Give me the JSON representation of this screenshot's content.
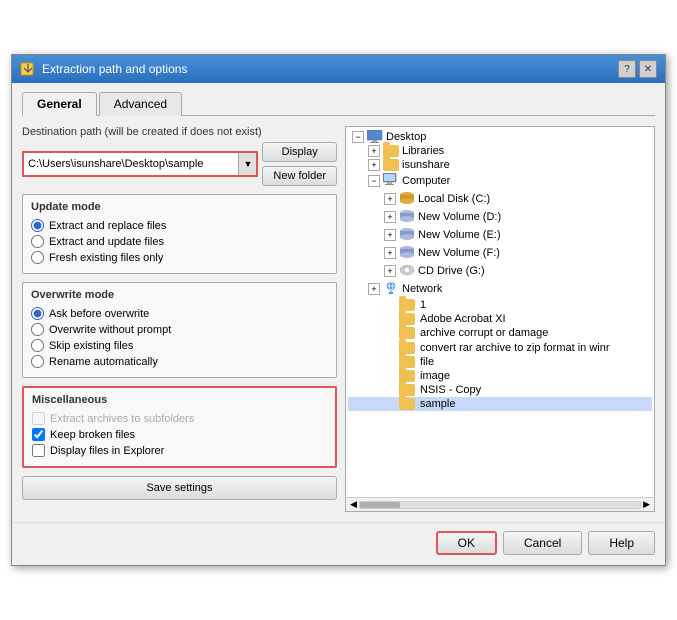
{
  "dialog": {
    "title": "Extraction path and options",
    "icon": "extract-icon"
  },
  "tabs": {
    "general": "General",
    "advanced": "Advanced"
  },
  "dest_path": {
    "label": "Destination path (will be created if does not exist)",
    "value": "C:\\Users\\isunshare\\Desktop\\sample",
    "display_btn": "Display",
    "new_folder_btn": "New folder"
  },
  "update_mode": {
    "label": "Update mode",
    "options": [
      {
        "id": "extract_replace",
        "label": "Extract and replace files",
        "checked": true
      },
      {
        "id": "extract_update",
        "label": "Extract and update files",
        "checked": false
      },
      {
        "id": "fresh_existing",
        "label": "Fresh existing files only",
        "checked": false
      }
    ]
  },
  "overwrite_mode": {
    "label": "Overwrite mode",
    "options": [
      {
        "id": "ask_before",
        "label": "Ask before overwrite",
        "checked": true
      },
      {
        "id": "overwrite_no_prompt",
        "label": "Overwrite without prompt",
        "checked": false
      },
      {
        "id": "skip_existing",
        "label": "Skip existing files",
        "checked": false
      },
      {
        "id": "rename_auto",
        "label": "Rename automatically",
        "checked": false
      }
    ]
  },
  "misc": {
    "label": "Miscellaneous",
    "options": [
      {
        "id": "extract_subfolders",
        "label": "Extract archives to subfolders",
        "checked": false,
        "enabled": false
      },
      {
        "id": "keep_broken",
        "label": "Keep broken files",
        "checked": true,
        "enabled": true
      },
      {
        "id": "display_explorer",
        "label": "Display files in Explorer",
        "checked": false,
        "enabled": true
      }
    ]
  },
  "save_settings": "Save settings",
  "tree": {
    "items": [
      {
        "level": 1,
        "expand": true,
        "label": "Desktop",
        "type": "desktop",
        "indent": 0
      },
      {
        "level": 2,
        "expand": true,
        "label": "Libraries",
        "type": "folder",
        "indent": 1
      },
      {
        "level": 2,
        "expand": true,
        "label": "isunshare",
        "type": "folder",
        "indent": 1
      },
      {
        "level": 2,
        "expand": false,
        "label": "Computer",
        "type": "computer",
        "indent": 1
      },
      {
        "level": 3,
        "expand": false,
        "label": "Local Disk (C:)",
        "type": "disk",
        "indent": 2
      },
      {
        "level": 3,
        "expand": false,
        "label": "New Volume (D:)",
        "type": "disk",
        "indent": 2
      },
      {
        "level": 3,
        "expand": false,
        "label": "New Volume (E:)",
        "type": "disk",
        "indent": 2
      },
      {
        "level": 3,
        "expand": false,
        "label": "New Volume (F:)",
        "type": "disk",
        "indent": 2
      },
      {
        "level": 3,
        "expand": false,
        "label": "CD Drive (G:)",
        "type": "disk",
        "indent": 2
      },
      {
        "level": 2,
        "expand": true,
        "label": "Network",
        "type": "network",
        "indent": 1
      },
      {
        "level": 3,
        "expand": false,
        "label": "1",
        "type": "folder",
        "indent": 2
      },
      {
        "level": 3,
        "expand": false,
        "label": "Adobe Acrobat XI",
        "type": "folder",
        "indent": 2
      },
      {
        "level": 3,
        "expand": false,
        "label": "archive corrupt or damage",
        "type": "folder",
        "indent": 2
      },
      {
        "level": 3,
        "expand": false,
        "label": "convert rar archive to zip format in winr",
        "type": "folder",
        "indent": 2
      },
      {
        "level": 3,
        "expand": false,
        "label": "file",
        "type": "folder",
        "indent": 2
      },
      {
        "level": 3,
        "expand": false,
        "label": "image",
        "type": "folder",
        "indent": 2
      },
      {
        "level": 3,
        "expand": false,
        "label": "NSIS - Copy",
        "type": "folder",
        "indent": 2
      },
      {
        "level": 3,
        "expand": false,
        "label": "sample",
        "type": "folder",
        "indent": 2,
        "selected": true
      }
    ]
  },
  "footer": {
    "ok": "OK",
    "cancel": "Cancel",
    "help": "Help"
  }
}
